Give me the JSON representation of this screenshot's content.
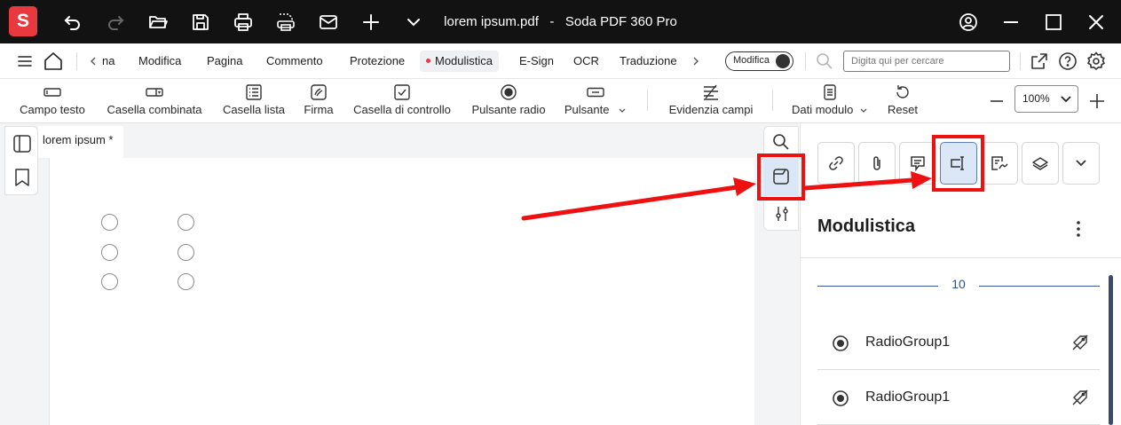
{
  "app": {
    "logo_letter": "S",
    "file_name": "lorem ipsum.pdf",
    "separator": "-",
    "product_name": "Soda PDF 360 Pro"
  },
  "menu": {
    "scroll_left_partial": "na",
    "items": [
      "Modifica",
      "Pagina",
      "Commento",
      "Protezione",
      "Modulistica",
      "E-Sign",
      "OCR",
      "Traduzione"
    ],
    "active": "Modulistica",
    "mode_toggle_label": "Modifica",
    "search_placeholder": "Digita qui per cercare"
  },
  "ribbon": {
    "buttons": [
      "Campo testo",
      "Casella combinata",
      "Casella lista",
      "Firma",
      "Casella di controllo",
      "Pulsante radio",
      "Pulsante",
      "Evidenzia campi",
      "Dati modulo",
      "Reset"
    ],
    "zoom": "100%"
  },
  "document": {
    "tab_label": "lorem ipsum *",
    "radio_rows": 3,
    "radio_columns": 2
  },
  "panel": {
    "title": "Modulistica",
    "page_number": "10",
    "fields": [
      {
        "name": "RadioGroup1"
      },
      {
        "name": "RadioGroup1"
      }
    ]
  },
  "colors": {
    "accent_red": "#e8393f",
    "highlight_red": "#ee1111",
    "selected_bg": "#dbe6f6",
    "titlebar_bg": "#121212"
  }
}
